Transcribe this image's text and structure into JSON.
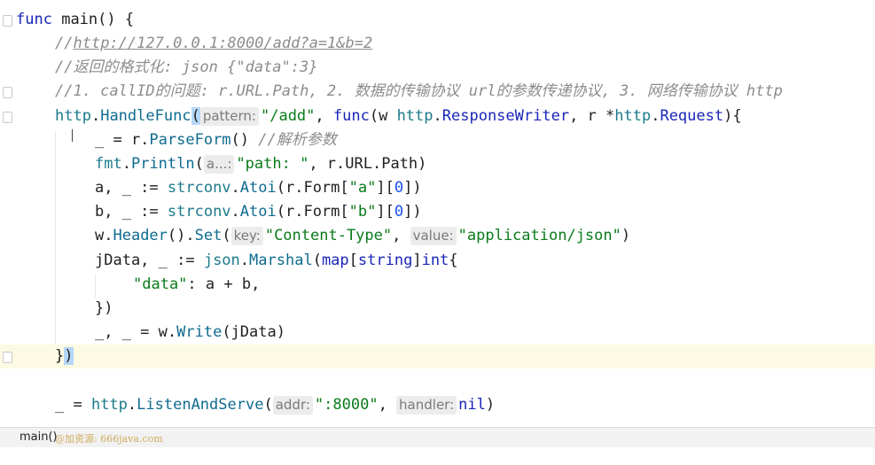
{
  "code": {
    "l1": {
      "kw": "func",
      "name": "main",
      "rest": "() {"
    },
    "l2": {
      "prefix": "//",
      "url": "http://127.0.0.1:8000/add?a=1&b=2"
    },
    "l3": {
      "text": "//返回的格式化: json {\"data\":3}"
    },
    "l4": {
      "text": "//1. callID的问题: r.URL.Path, 2. 数据的传输协议 url的参数传递协议, 3. 网络传输协议 http"
    },
    "l5": {
      "pkg": "http",
      "dot": ".",
      "fn": "HandleFunc",
      "open": "(",
      "hint": "pattern:",
      "str": "\"/add\"",
      "comma": ", ",
      "kw": "func",
      "p1": "(w ",
      "pkg2": "http",
      "dot2": ".",
      "type1": "ResponseWriter",
      "p2": ", r *",
      "pkg3": "http",
      "dot3": ".",
      "type2": "Request",
      "p3": "){"
    },
    "l6": {
      "pre": "_ = r.",
      "fn": "ParseForm",
      "mid": "() ",
      "cmt": "//解析参数"
    },
    "l7": {
      "pkg": "fmt",
      "dot": ".",
      "fn": "Println",
      "open": "(",
      "hint": "a...:",
      "str": "\"path: \"",
      "rest": ", r.URL.Path)"
    },
    "l8": {
      "pre": "a, _ := ",
      "pkg": "strconv",
      "dot": ".",
      "fn": "Atoi",
      "mid": "(r.Form[",
      "str": "\"a\"",
      "mid2": "][",
      "num": "0",
      "end": "])"
    },
    "l9": {
      "pre": "b, _ := ",
      "pkg": "strconv",
      "dot": ".",
      "fn": "Atoi",
      "mid": "(r.Form[",
      "str": "\"b\"",
      "mid2": "][",
      "num": "0",
      "end": "])"
    },
    "l10": {
      "pre": "w.",
      "fn": "Header",
      "mid": "().",
      "fn2": "Set",
      "open": "(",
      "hint1": "key:",
      "str1": "\"Content-Type\"",
      "comma": ", ",
      "hint2": "value:",
      "str2": "\"application/json\"",
      "end": ")"
    },
    "l11": {
      "pre": "jData, _ := ",
      "pkg": "json",
      "dot": ".",
      "fn": "Marshal",
      "open": "(",
      "kw1": "map",
      "b1": "[",
      "kw2": "string",
      "b2": "]",
      "kw3": "int",
      "end": "{"
    },
    "l12": {
      "str": "\"data\"",
      "rest": ": a + b,"
    },
    "l13": {
      "text": "})"
    },
    "l14": {
      "pre": "_, _ = w.",
      "fn": "Write",
      "rest": "(jData)"
    },
    "l15": {
      "brace": "}",
      "paren": ")"
    },
    "l17": {
      "pre": "_ = ",
      "pkg": "http",
      "dot": ".",
      "fn": "ListenAndServe",
      "open": "(",
      "hint1": "addr:",
      "str": "\":8000\"",
      "comma": ", ",
      "hint2": "handler:",
      "kw": "nil",
      "end": ")"
    }
  },
  "statusbar": {
    "breadcrumb": "main()",
    "watermark": "@加资源: 666java.com"
  }
}
